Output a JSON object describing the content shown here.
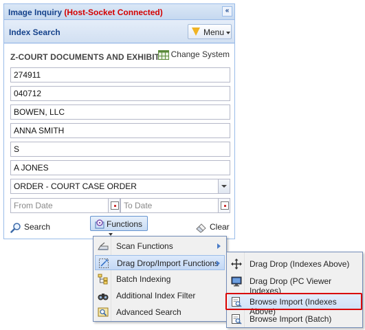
{
  "panel": {
    "title_main": "Image Inquiry ",
    "title_status": "(Host-Socket Connected)",
    "collapse_icon": "«",
    "subheader": "Index Search",
    "menu_label": "Menu"
  },
  "system": {
    "name": "Z-COURT DOCUMENTS AND EXHIBITS",
    "change_label": "Change System"
  },
  "fields": [
    {
      "value": "274911"
    },
    {
      "value": "040712"
    },
    {
      "value": "BOWEN, LLC"
    },
    {
      "value": "ANNA SMITH"
    },
    {
      "value": "S"
    },
    {
      "value": "A JONES"
    }
  ],
  "doctype": {
    "value": "ORDER - COURT CASE ORDER"
  },
  "dates": {
    "from_placeholder": "From Date",
    "to_placeholder": "To Date"
  },
  "toolbar": {
    "search_label": "Search",
    "functions_label": "Functions",
    "clear_label": "Clear"
  },
  "functions_menu": {
    "items": [
      {
        "label": "Scan Functions",
        "icon": "scanner-icon"
      },
      {
        "label": "Drag Drop/Import Functions",
        "icon": "drag-drop-icon"
      },
      {
        "label": "Batch Indexing",
        "icon": "batch-tree-icon"
      },
      {
        "label": "Additional Index Filter",
        "icon": "binoculars-icon"
      },
      {
        "label": "Advanced Search",
        "icon": "advanced-search-icon"
      }
    ]
  },
  "submenu": {
    "items": [
      {
        "label": "Drag Drop (Indexes Above)",
        "icon": "move-arrows-icon"
      },
      {
        "label": "Drag Drop (PC Viewer Indexes)",
        "icon": "monitor-icon"
      },
      {
        "label": "Browse Import (Indexes Above)",
        "icon": "browse-import-icon"
      },
      {
        "label": "Browse Import (Batch)",
        "icon": "browse-import-batch-icon"
      }
    ]
  },
  "colors": {
    "panel_header_text": "#15428b",
    "status_red": "#d40000",
    "highlight_border": "#d90000",
    "panel_border": "#99bbe8"
  }
}
